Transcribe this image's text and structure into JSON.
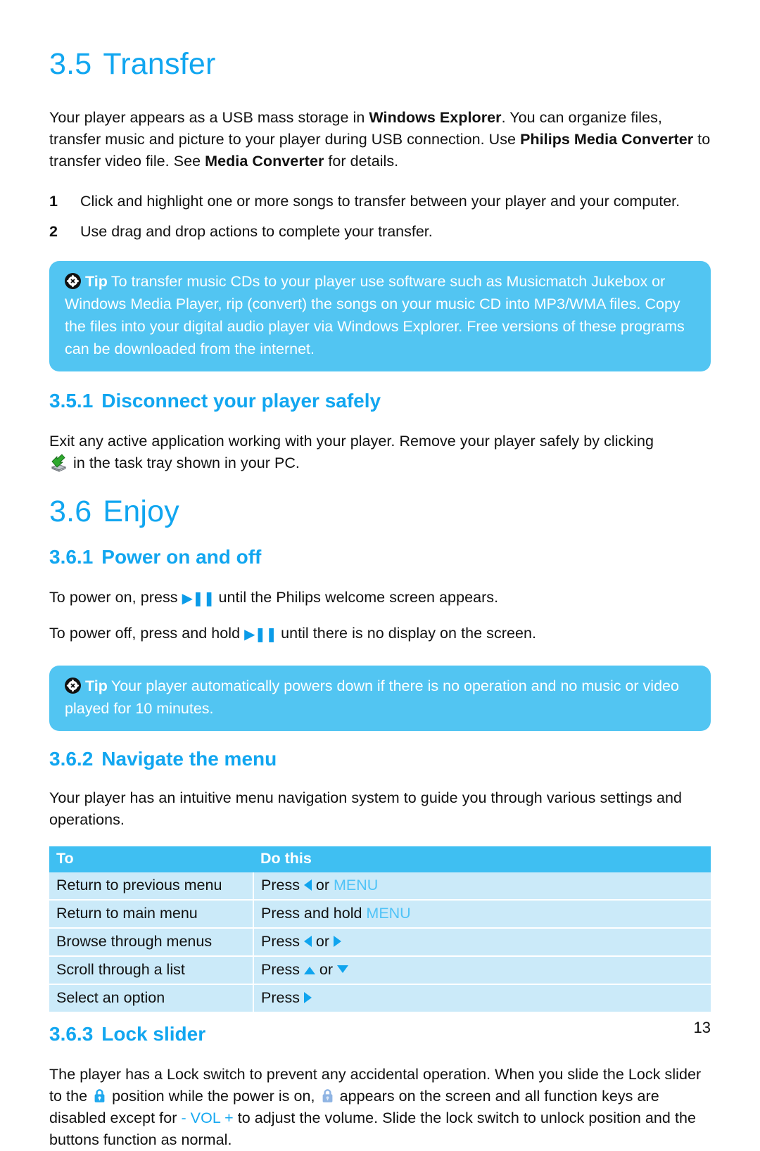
{
  "colors": {
    "heading_blue": "#11A6F0",
    "tip_box_blue": "#52C5F2",
    "table_header_blue": "#3FBFF2",
    "table_row_blue": "#CBEAF9",
    "glyph_blue": "#0FA4EE",
    "menu_blue": "#4FC3F7",
    "lock_on_blue": "#1FA8EE",
    "lock_screen_blue": "#8FB4E3",
    "text_black": "#111111"
  },
  "sections": {
    "transfer": {
      "number": "3.5",
      "title": "Transfer",
      "intro": {
        "part1": "Your player appears as a USB mass storage in ",
        "bold1": "Windows Explorer",
        "part2": ". You can organize files, transfer music and picture to your player during USB connection. Use ",
        "bold2": "Philips Media Converter",
        "part3": " to transfer video file. See ",
        "bold3": "Media Converter",
        "part4": " for details."
      },
      "steps": [
        {
          "num": "1",
          "text": "Click and highlight one or more songs to transfer between your player and your computer."
        },
        {
          "num": "2",
          "text": "Use drag and drop actions to complete your transfer."
        }
      ],
      "tip": {
        "icon": "asterisk-icon",
        "label": "Tip",
        "text": "To transfer music CDs to your player use software such as Musicmatch Jukebox or Windows Media Player, rip (convert) the songs on your music CD into MP3/WMA files. Copy the files into your digital audio player via Windows Explorer. Free versions of these programs can be downloaded from the internet."
      }
    },
    "disconnect": {
      "number": "3.5.1",
      "title": "Disconnect your player safely",
      "text_before": "Exit any active application working with your player. Remove your player safely by clicking",
      "icon": "safely-remove-hardware-icon",
      "text_after": "in the task tray shown in your PC."
    },
    "enjoy": {
      "number": "3.6",
      "title": "Enjoy"
    },
    "power": {
      "number": "3.6.1",
      "title": "Power on and off",
      "line1_before": "To power on, press ",
      "line1_glyph": "play-pause-icon",
      "line1_after": " until the Philips welcome screen appears.",
      "line2_before": "To power off, press and hold ",
      "line2_glyph": "play-pause-icon",
      "line2_after": " until there is no display on the screen.",
      "tip": {
        "icon": "asterisk-icon",
        "label": "Tip",
        "text": "Your player automatically powers down if there is no operation and no music or video played for 10 minutes."
      }
    },
    "navigate": {
      "number": "3.6.2",
      "title": "Navigate the menu",
      "intro": "Your player has an intuitive menu navigation system to guide you through various settings and operations.",
      "table": {
        "headers": [
          "To",
          "Do this"
        ],
        "rows": [
          {
            "to": "Return to previous menu",
            "do_parts": [
              {
                "type": "text",
                "value": "Press "
              },
              {
                "type": "glyph",
                "value": "triangle-left-icon"
              },
              {
                "type": "text",
                "value": " or "
              },
              {
                "type": "menu",
                "value": "MENU"
              }
            ]
          },
          {
            "to": "Return to main menu",
            "do_parts": [
              {
                "type": "text",
                "value": "Press and hold "
              },
              {
                "type": "menu",
                "value": "MENU"
              }
            ]
          },
          {
            "to": "Browse through menus",
            "do_parts": [
              {
                "type": "text",
                "value": "Press "
              },
              {
                "type": "glyph",
                "value": "triangle-left-icon"
              },
              {
                "type": "text",
                "value": " or "
              },
              {
                "type": "glyph",
                "value": "triangle-right-icon"
              }
            ]
          },
          {
            "to": "Scroll through a list",
            "do_parts": [
              {
                "type": "text",
                "value": "Press "
              },
              {
                "type": "glyph",
                "value": "triangle-up-icon"
              },
              {
                "type": "text",
                "value": " or "
              },
              {
                "type": "glyph",
                "value": "triangle-down-icon"
              }
            ]
          },
          {
            "to": "Select an option",
            "do_parts": [
              {
                "type": "text",
                "value": "Press "
              },
              {
                "type": "glyph",
                "value": "triangle-right-icon"
              }
            ]
          }
        ]
      }
    },
    "lock": {
      "number": "3.6.3",
      "title": "Lock slider",
      "part1": "The player has a Lock switch to prevent any accidental operation. When you slide the Lock slider to the ",
      "icon1": "lock-closed-blue-icon",
      "part2": " position while the power is on, ",
      "icon2": "lock-screen-indicator-icon",
      "part3": " appears on the screen and all function keys are disabled except for ",
      "vol": "- VOL +",
      "part4": " to adjust the volume. Slide the lock switch to unlock position and the buttons function as normal."
    }
  },
  "footer": {
    "page_number": "13"
  }
}
